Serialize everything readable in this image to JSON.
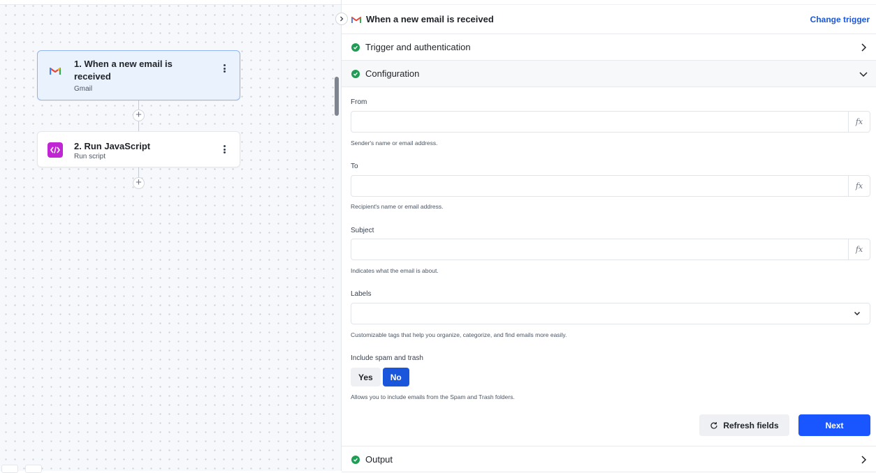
{
  "canvas": {
    "nodes": [
      {
        "title": "1. When a new email is received",
        "subtitle": "Gmail",
        "icon": "gmail-icon"
      },
      {
        "title": "2. Run JavaScript",
        "subtitle": "Run script",
        "icon": "code-icon"
      }
    ],
    "add_symbol": "+"
  },
  "panel": {
    "header": {
      "title": "When a new email is received",
      "change_trigger": "Change trigger"
    },
    "sections": {
      "trigger_auth": "Trigger and authentication",
      "configuration": "Configuration",
      "output": "Output"
    },
    "fields": {
      "from": {
        "label": "From",
        "value": "",
        "help": "Sender's name or email address.",
        "fx": "fx"
      },
      "to": {
        "label": "To",
        "value": "",
        "help": "Recipient's name or email address.",
        "fx": "fx"
      },
      "subject": {
        "label": "Subject",
        "value": "",
        "help": "Indicates what the email is about.",
        "fx": "fx"
      },
      "labels": {
        "label": "Labels",
        "value": "",
        "help": "Customizable tags that help you organize, categorize, and find emails more easily."
      }
    },
    "spam": {
      "label": "Include spam and trash",
      "yes": "Yes",
      "no": "No",
      "selected": "No",
      "help": "Allows you to include emails from the Spam and Trash folders."
    },
    "buttons": {
      "refresh": "Refresh fields",
      "next": "Next"
    }
  },
  "colors": {
    "accent": "#1a56db",
    "success": "#1f9d55",
    "script_icon": "#c026d3",
    "gmail_red": "#ea4335"
  }
}
